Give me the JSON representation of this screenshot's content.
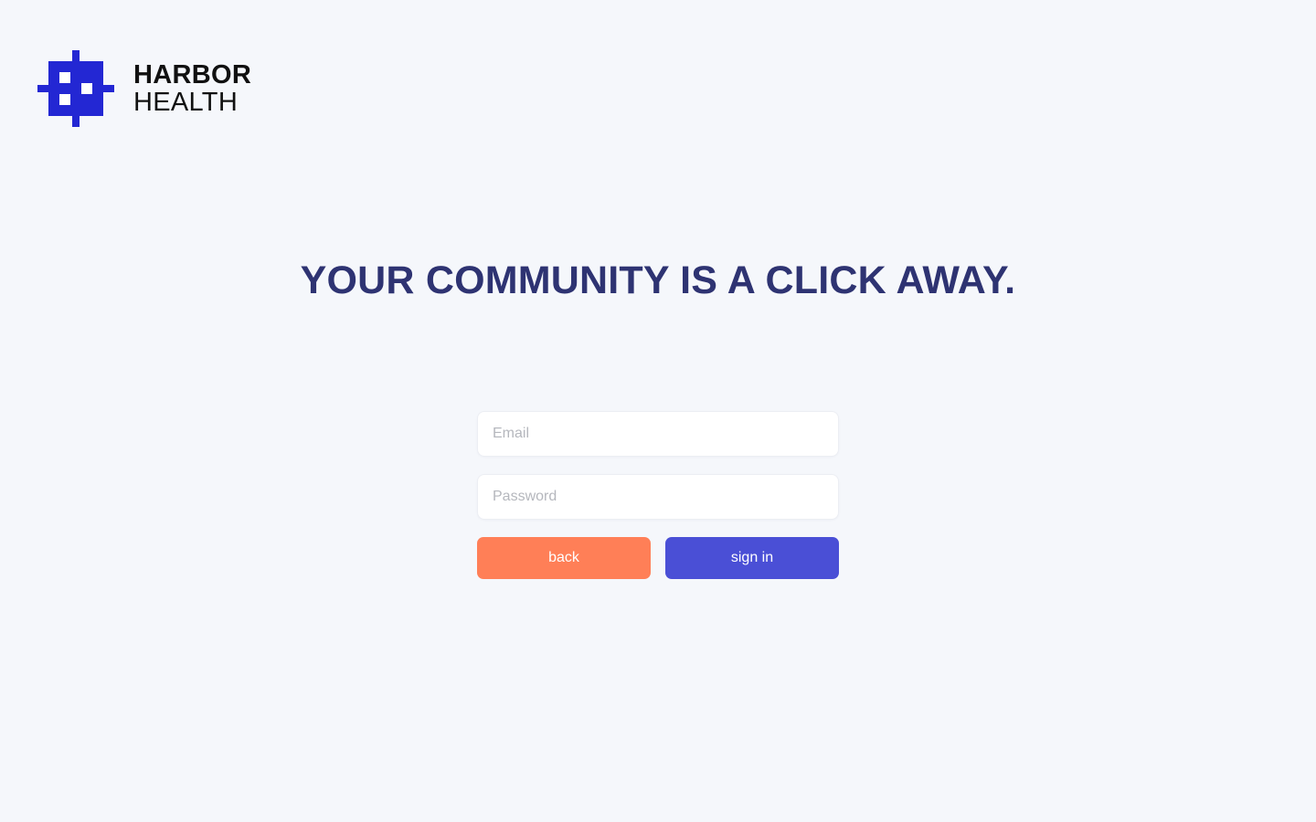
{
  "brand": {
    "name_line1": "HARBOR",
    "name_line2": "HEALTH",
    "logo_icon": "pixel-cross-logo",
    "color": "#2327d3"
  },
  "headline": "YOUR COMMUNITY IS A CLICK AWAY.",
  "form": {
    "email": {
      "placeholder": "Email",
      "value": ""
    },
    "password": {
      "placeholder": "Password",
      "value": ""
    },
    "back_label": "back",
    "signin_label": "sign in"
  },
  "colors": {
    "background": "#f5f7fb",
    "headline": "#2e3372",
    "back_button": "#ff7f57",
    "signin_button": "#4a4fd6"
  }
}
